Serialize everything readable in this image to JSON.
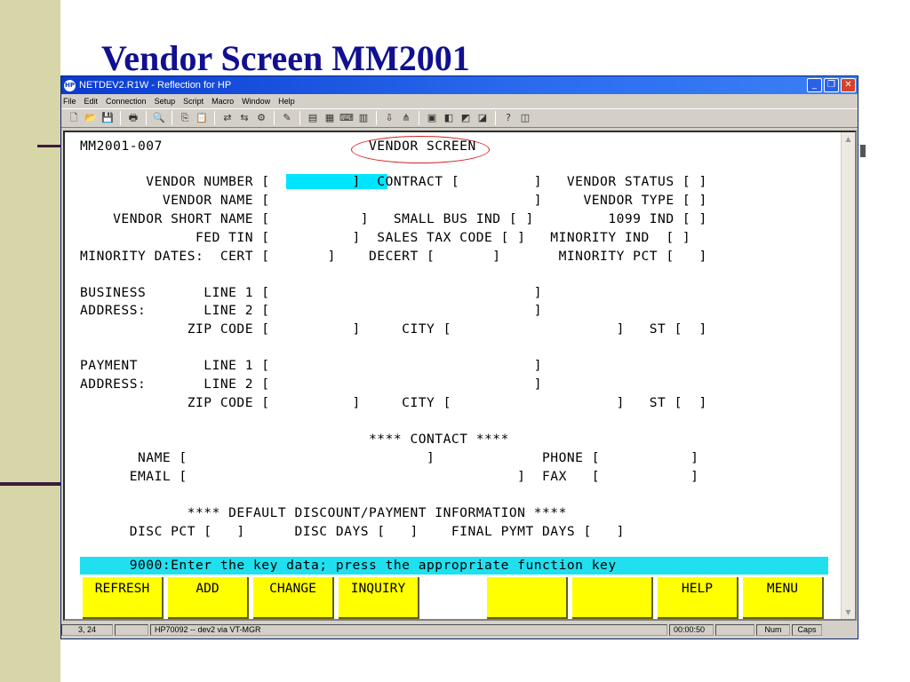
{
  "slide": {
    "title": "Vendor Screen MM2001"
  },
  "window": {
    "title": "NETDEV2.R1W - Reflection for HP",
    "menu": [
      "File",
      "Edit",
      "Connection",
      "Setup",
      "Script",
      "Macro",
      "Window",
      "Help"
    ]
  },
  "terminal": {
    "lines": [
      "MM2001-007                         VENDOR SCREEN",
      "",
      "        VENDOR NUMBER [          ]  CONTRACT [         ]   VENDOR STATUS [ ]",
      "          VENDOR NAME [                                ]     VENDOR TYPE [ ]",
      "    VENDOR SHORT NAME [           ]   SMALL BUS IND [ ]         1099 IND [ ]",
      "              FED TIN [          ]  SALES TAX CODE [ ]   MINORITY IND  [ ]",
      "MINORITY DATES:  CERT [       ]    DECERT [       ]       MINORITY PCT [   ]",
      "",
      "BUSINESS       LINE 1 [                                ]",
      "ADDRESS:       LINE 2 [                                ]",
      "             ZIP CODE [          ]     CITY [                    ]   ST [  ]",
      "",
      "PAYMENT        LINE 1 [                                ]",
      "ADDRESS:       LINE 2 [                                ]",
      "             ZIP CODE [          ]     CITY [                    ]   ST [  ]",
      "",
      "                                   **** CONTACT ****",
      "       NAME [                             ]             PHONE [           ]",
      "      EMAIL [                                        ]  FAX   [           ]",
      "",
      "             **** DEFAULT DISCOUNT/PAYMENT INFORMATION ****",
      "      DISC PCT [   ]      DISC DAYS [   ]    FINAL PYMT DAYS [   ]"
    ],
    "message": "      9000:Enter the key data; press the appropriate function key",
    "function_keys": [
      "REFRESH",
      "ADD",
      "CHANGE",
      "INQUIRY",
      "",
      "",
      "",
      "HELP",
      "MENU"
    ]
  },
  "statusbar": {
    "cursor_pos": "3, 24",
    "connection": "HP70092 -- dev2 via VT-MGR",
    "timer": "00:00:50",
    "num": "Num",
    "caps": "Caps"
  }
}
